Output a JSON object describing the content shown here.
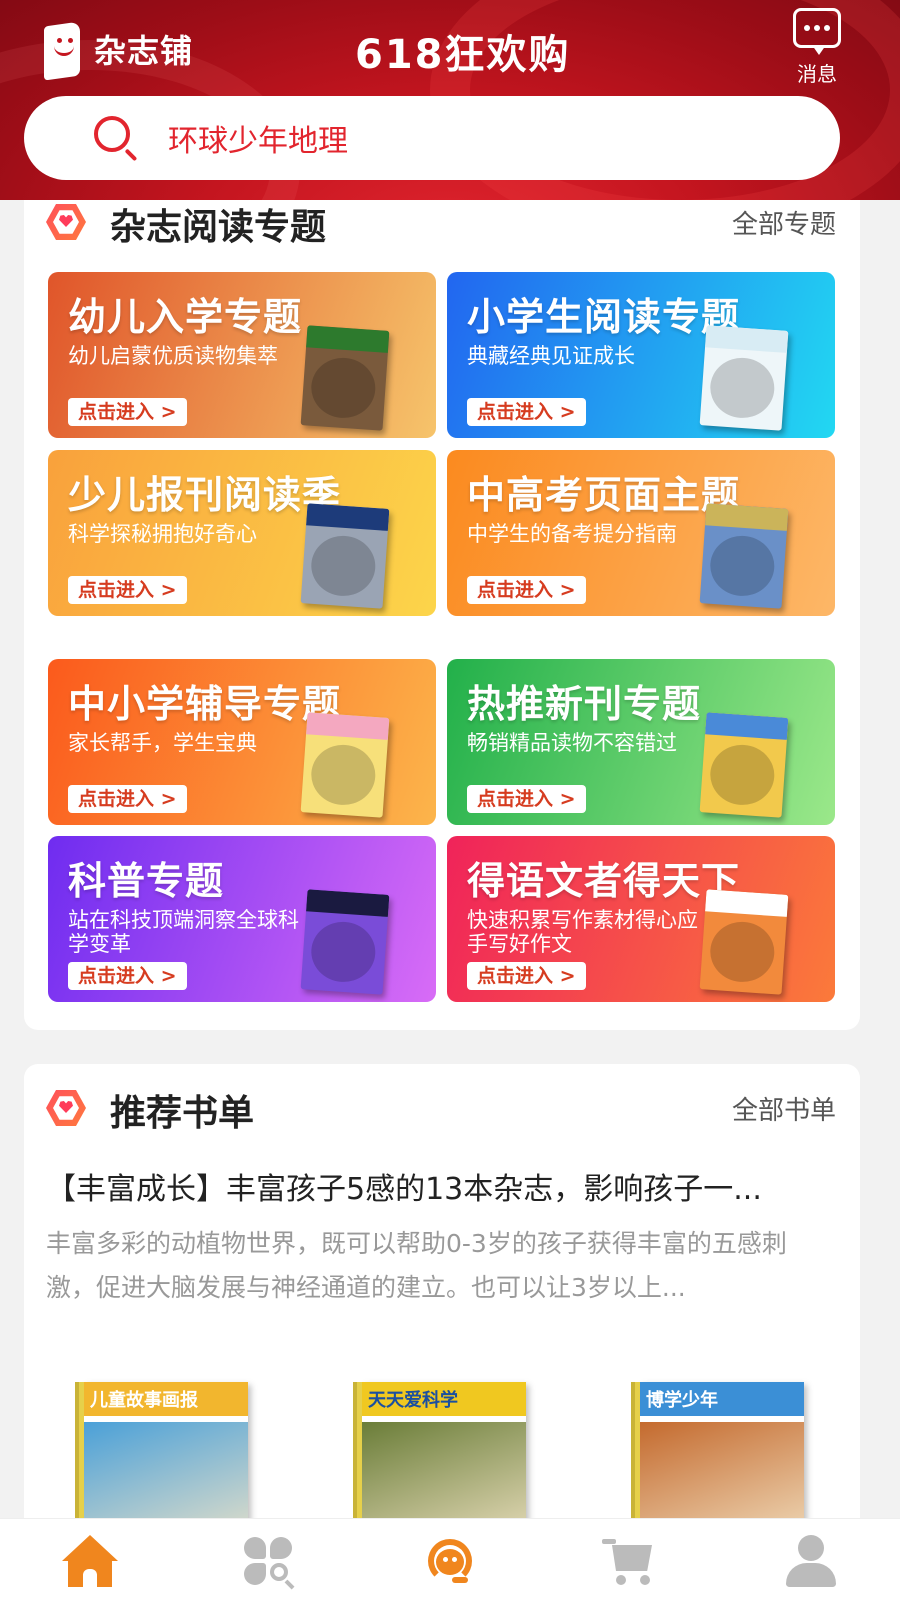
{
  "header": {
    "logo_text": "杂志铺",
    "promo_title": "618狂欢购",
    "message_label": "消息",
    "search_value": "环球少年地理"
  },
  "topics_section": {
    "title": "杂志阅读专题",
    "more": "全部专题",
    "cards": [
      {
        "title": "幼儿入学专题",
        "subtitle": "幼儿启蒙优质读物集萃",
        "button": "点击进入 >",
        "colors": [
          "#e0552a",
          "#f6c46b"
        ]
      },
      {
        "title": "小学生阅读专题",
        "subtitle": "典藏经典见证成长",
        "button": "点击进入 >",
        "colors": [
          "#2266f0",
          "#22d8f2"
        ]
      },
      {
        "title": "少儿报刊阅读季",
        "subtitle": "科学探秘拥抱好奇心",
        "button": "点击进入 >",
        "colors": [
          "#f9a13c",
          "#fcd54a"
        ]
      },
      {
        "title": "中高考页面主题",
        "subtitle": "中学生的备考提分指南",
        "button": "点击进入 >",
        "colors": [
          "#fb8a1f",
          "#fdb767"
        ]
      },
      {
        "title": "中小学辅导专题",
        "subtitle": "家长帮手，学生宝典",
        "button": "点击进入 >",
        "colors": [
          "#fb5a1c",
          "#fcb54b"
        ]
      },
      {
        "title": "热推新刊专题",
        "subtitle": "畅销精品读物不容错过",
        "button": "点击进入 >",
        "colors": [
          "#22b04a",
          "#9be88a"
        ]
      },
      {
        "title": "科普专题",
        "subtitle": "站在科技顶端洞察全球科学变革",
        "button": "点击进入 >",
        "colors": [
          "#6f2cf0",
          "#d86cf6"
        ]
      },
      {
        "title": "得语文者得天下",
        "subtitle": "快速积累写作素材得心应手写好作文",
        "button": "点击进入 >",
        "colors": [
          "#f0235a",
          "#fb7a3a"
        ]
      }
    ]
  },
  "recommend_section": {
    "title": "推荐书单",
    "more": "全部书单",
    "list_title": "【丰富成长】丰富孩子5感的13本杂志，影响孩子一...",
    "list_desc": "丰富多彩的动植物世界，既可以帮助0-3岁的孩子获得丰富的五感刺激，促进大脑发展与神经通道的建立。也可以让3岁以上...",
    "books": [
      {
        "cover_text": "儿童故事画报",
        "accent": "#f2b62e",
        "image": "#4aa0d8"
      },
      {
        "cover_text": "天天爱科学",
        "accent": "#f0c820",
        "image": "#6a7d38"
      },
      {
        "cover_text": "博学少年",
        "accent": "#3b8fd6",
        "image": "#c46a2e"
      }
    ]
  },
  "tabbar": {
    "items": [
      {
        "icon": "home-icon",
        "active": true
      },
      {
        "icon": "category-search-icon",
        "active": false
      },
      {
        "icon": "customer-service-icon",
        "active": true
      },
      {
        "icon": "cart-icon",
        "active": false
      },
      {
        "icon": "user-icon",
        "active": false
      }
    ]
  }
}
